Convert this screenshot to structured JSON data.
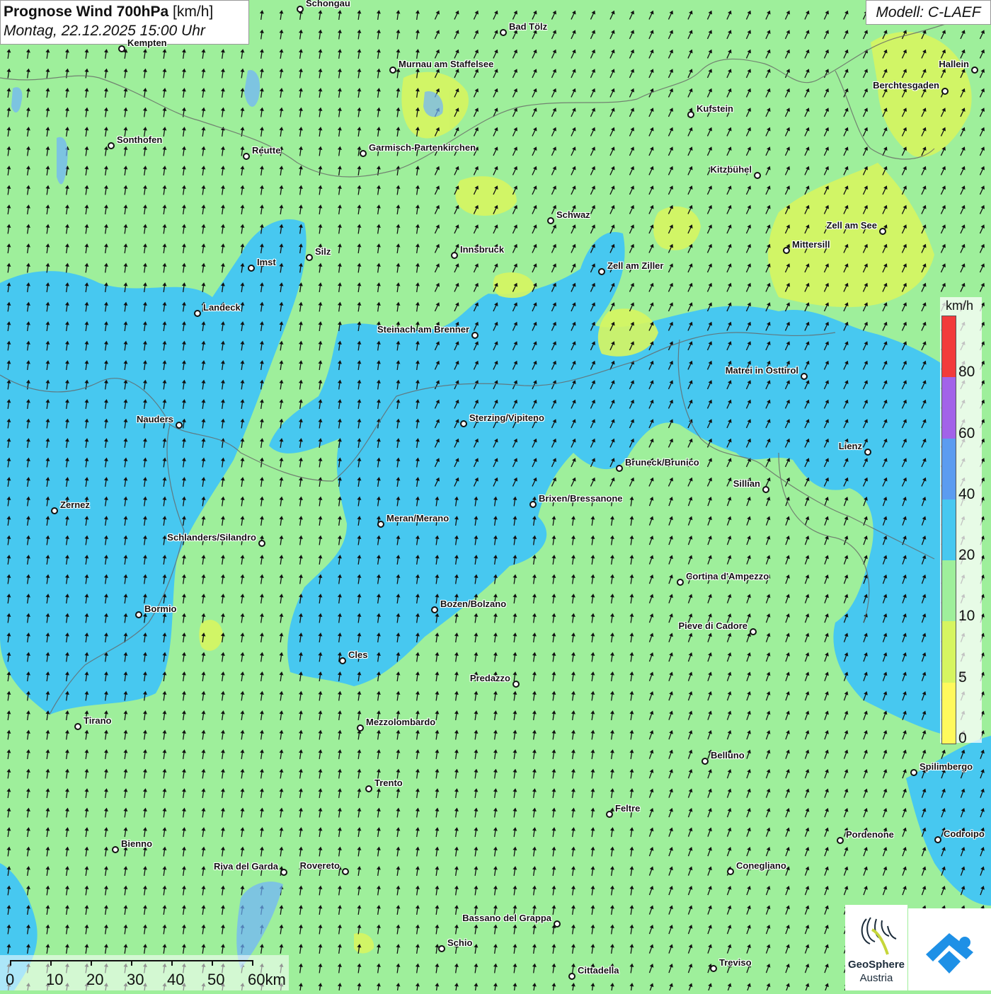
{
  "header": {
    "title_bold": "Prognose Wind 700hPa",
    "title_unit": "[km/h]",
    "subtitle": "Montag, 22.12.2025 15:00 Uhr"
  },
  "model": {
    "label": "Modell: C-LAEF"
  },
  "legend": {
    "unit": "km/h",
    "ticks": [
      "0",
      "5",
      "10",
      "20",
      "40",
      "60",
      "80"
    ],
    "colors": [
      "#fff95c",
      "#d6f560",
      "#9eef9b",
      "#47c8f0",
      "#5b9cf0",
      "#a263e9",
      "#f23b3b"
    ]
  },
  "scalebar": {
    "labels": [
      "0",
      "10",
      "20",
      "30",
      "40",
      "50",
      "60km"
    ]
  },
  "branding": {
    "logo_name": "GeoSphere",
    "logo_sub": "Austria"
  },
  "cities": [
    {
      "name": "Schongau"
    },
    {
      "name": "Bad Tölz"
    },
    {
      "name": "Kempten"
    },
    {
      "name": "Murnau am Staffelsee"
    },
    {
      "name": "Hallein"
    },
    {
      "name": "Berchtesgaden"
    },
    {
      "name": "Kufstein"
    },
    {
      "name": "Sonthofen"
    },
    {
      "name": "Reutte"
    },
    {
      "name": "Garmisch-Partenkirchen"
    },
    {
      "name": "Kitzbühel"
    },
    {
      "name": "Schwaz"
    },
    {
      "name": "Zell am See"
    },
    {
      "name": "Mittersill"
    },
    {
      "name": "Imst"
    },
    {
      "name": "Silz"
    },
    {
      "name": "Innsbruck"
    },
    {
      "name": "Zell am Ziller"
    },
    {
      "name": "Landeck"
    },
    {
      "name": "Steinach am Brenner"
    },
    {
      "name": "Matrei in Osttirol"
    },
    {
      "name": "Nauders"
    },
    {
      "name": "Sterzing/Vipiteno"
    },
    {
      "name": "Lienz"
    },
    {
      "name": "Bruneck/Brunico"
    },
    {
      "name": "Sillian"
    },
    {
      "name": "Zernez"
    },
    {
      "name": "Brixen/Bressanone"
    },
    {
      "name": "Meran/Merano"
    },
    {
      "name": "Schlanders/Silandro"
    },
    {
      "name": "Cortina d'Ampezzo"
    },
    {
      "name": "Bozen/Bolzano"
    },
    {
      "name": "Bormio"
    },
    {
      "name": "Pieve di Cadore"
    },
    {
      "name": "Cles"
    },
    {
      "name": "Predazzo"
    },
    {
      "name": "Tirano"
    },
    {
      "name": "Mezzolombardo"
    },
    {
      "name": "Belluno"
    },
    {
      "name": "Spilimbergo"
    },
    {
      "name": "Trento"
    },
    {
      "name": "Feltre"
    },
    {
      "name": "Pordenone"
    },
    {
      "name": "Codroipo"
    },
    {
      "name": "Bienno"
    },
    {
      "name": "Riva del Garda"
    },
    {
      "name": "Rovereto"
    },
    {
      "name": "Conegliano"
    },
    {
      "name": "Bassano del Grappa"
    },
    {
      "name": "Schio"
    },
    {
      "name": "Treviso"
    },
    {
      "name": "Cittadella"
    }
  ]
}
